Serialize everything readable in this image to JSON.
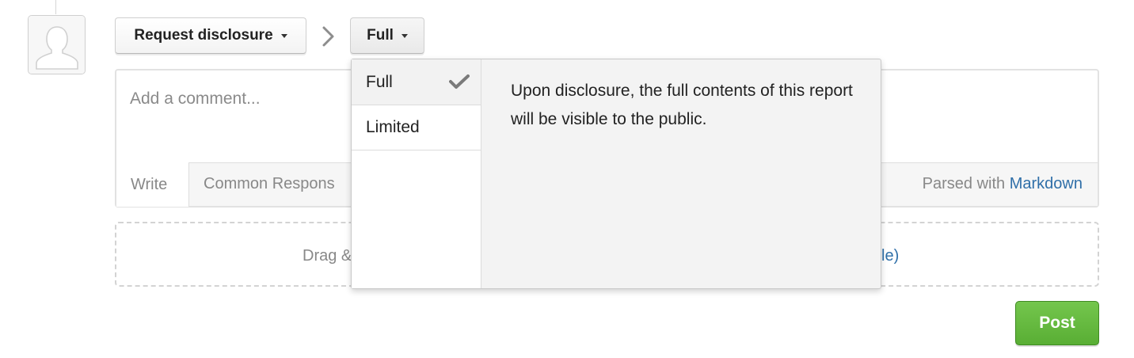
{
  "toolbar": {
    "disclosure_label": "Request disclosure",
    "visibility_label": "Full"
  },
  "composer": {
    "placeholder": "Add a comment...",
    "tab_write": "Write",
    "tab_common": "Common Respons",
    "parsed_prefix": "Parsed with",
    "parsed_link": "Markdown"
  },
  "dropzone": {
    "text_left": "Drag &",
    "text_right": "file)"
  },
  "post_label": "Post",
  "dropdown": {
    "options": [
      {
        "label": "Full",
        "selected": true
      },
      {
        "label": "Limited",
        "selected": false
      }
    ],
    "description": "Upon disclosure, the full contents of this report will be visible to the public."
  },
  "icons": {
    "avatar": "user-silhouette-icon",
    "separator": "chevron-right-icon",
    "selected": "check-icon",
    "caret": "caret-down-icon"
  },
  "colors": {
    "post_green": "#5fb43a",
    "link_blue": "#2f6fa8"
  }
}
